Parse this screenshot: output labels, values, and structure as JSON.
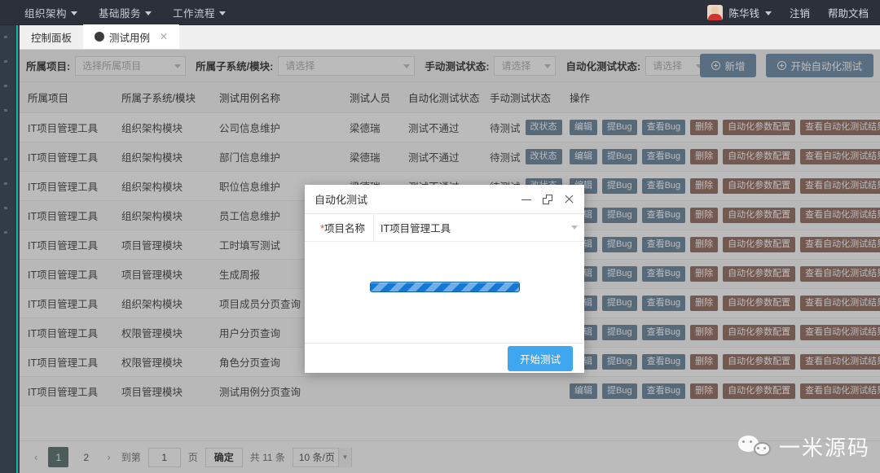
{
  "topnav": {
    "items": [
      {
        "label": "组织架构",
        "icon": "chevron-down-icon"
      },
      {
        "label": "基础服务",
        "icon": "chevron-down-icon"
      },
      {
        "label": "工作流程",
        "icon": "chevron-down-icon"
      }
    ],
    "user_name": "陈华钱",
    "logout_label": "注销",
    "help_label": "帮助文档"
  },
  "tabs": [
    {
      "label": "控制面板",
      "active": false,
      "closable": false
    },
    {
      "label": "测试用例",
      "active": true,
      "closable": true
    }
  ],
  "filters": [
    {
      "label": "所属项目:",
      "value": "选择所属项目",
      "width": "w1"
    },
    {
      "label": "所属子系统/模块:",
      "value": "请选择",
      "width": "w2"
    },
    {
      "label": "手动测试状态:",
      "value": "请选择",
      "width": "w3"
    },
    {
      "label": "自动化测试状态:",
      "value": "请选择",
      "width": "w4"
    }
  ],
  "toolbar": {
    "add_label": "新增",
    "start_auto_test_label": "开始自动化测试"
  },
  "table": {
    "headers": [
      "所属项目",
      "所属子系统/模块",
      "测试用例名称",
      "测试人员",
      "自动化测试状态",
      "手动测试状态",
      "操作"
    ],
    "manual_status_button": "改状态",
    "ops": [
      {
        "label": "编辑",
        "style": "b-blue"
      },
      {
        "label": "提Bug",
        "style": "b-blue"
      },
      {
        "label": "查看Bug",
        "style": "b-blue"
      },
      {
        "label": "删除",
        "style": "b-red"
      },
      {
        "label": "自动化参数配置",
        "style": "b-red"
      },
      {
        "label": "查看自动化测试结果",
        "style": "b-red"
      }
    ],
    "rows": [
      {
        "project": "IT项目管理工具",
        "module": "组织架构模块",
        "casename": "公司信息维护",
        "tester": "梁德瑞",
        "auto_status": "测试不通过",
        "manual_status": "待测试"
      },
      {
        "project": "IT项目管理工具",
        "module": "组织架构模块",
        "casename": "部门信息维护",
        "tester": "梁德瑞",
        "auto_status": "测试不通过",
        "manual_status": "待测试"
      },
      {
        "project": "IT项目管理工具",
        "module": "组织架构模块",
        "casename": "职位信息维护",
        "tester": "梁德瑞",
        "auto_status": "测试不通过",
        "manual_status": "待测试"
      },
      {
        "project": "IT项目管理工具",
        "module": "组织架构模块",
        "casename": "员工信息维护",
        "tester": "",
        "auto_status": "",
        "manual_status": ""
      },
      {
        "project": "IT项目管理工具",
        "module": "项目管理模块",
        "casename": "工时填写测试",
        "tester": "",
        "auto_status": "",
        "manual_status": ""
      },
      {
        "project": "IT项目管理工具",
        "module": "项目管理模块",
        "casename": "生成周报",
        "tester": "",
        "auto_status": "",
        "manual_status": ""
      },
      {
        "project": "IT项目管理工具",
        "module": "组织架构模块",
        "casename": "项目成员分页查询",
        "tester": "",
        "auto_status": "",
        "manual_status": ""
      },
      {
        "project": "IT项目管理工具",
        "module": "权限管理模块",
        "casename": "用户分页查询",
        "tester": "",
        "auto_status": "",
        "manual_status": ""
      },
      {
        "project": "IT项目管理工具",
        "module": "权限管理模块",
        "casename": "角色分页查询",
        "tester": "",
        "auto_status": "",
        "manual_status": ""
      },
      {
        "project": "IT项目管理工具",
        "module": "项目管理模块",
        "casename": "测试用例分页查询",
        "tester": "",
        "auto_status": "",
        "manual_status": ""
      }
    ]
  },
  "pagination": {
    "prev_icon": "‹",
    "next_icon": "›",
    "pages": [
      "1",
      "2"
    ],
    "active_page": "1",
    "goto_label": "到第",
    "goto_value": "1",
    "page_unit": "页",
    "confirm_label": "确定",
    "total_label": "共 11 条",
    "page_size": "10 条/页"
  },
  "modal": {
    "title": "自动化测试",
    "minimize_icon": "minimize-icon",
    "maximize_icon": "maximize-icon",
    "close_icon": "close-icon",
    "field_label": "项目名称",
    "required_mark": "*",
    "field_value": "IT项目管理工具",
    "submit_label": "开始测试"
  },
  "watermark": {
    "text": "一米源码"
  },
  "colors": {
    "accent_blue": "#1890ff",
    "danger_red": "#e74c1e",
    "teal": "#14b8a6",
    "pager_active": "#0b7a6b",
    "topbar": "#2b303b"
  }
}
